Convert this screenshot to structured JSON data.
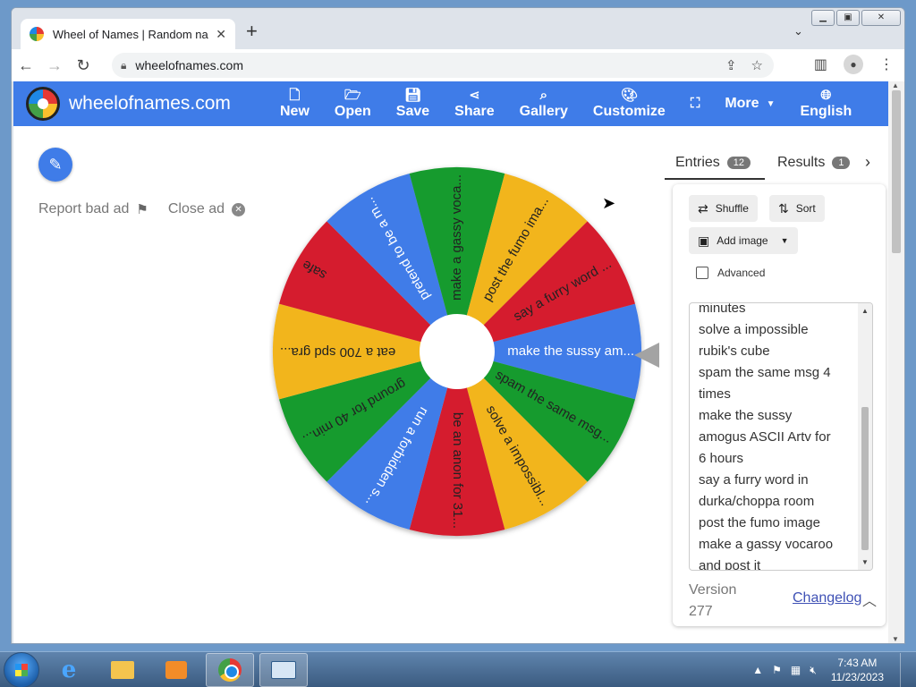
{
  "browser": {
    "tab_title": "Wheel of Names | Random name",
    "url": "wheelofnames.com",
    "window_controls": [
      "minimize-icon",
      "maximize-icon",
      "close-icon"
    ]
  },
  "appbar": {
    "brand": "wheelofnames.com",
    "menu": [
      {
        "label": "New",
        "icon": "file-icon"
      },
      {
        "label": "Open",
        "icon": "folder-open-icon"
      },
      {
        "label": "Save",
        "icon": "floppy-icon"
      },
      {
        "label": "Share",
        "icon": "share-icon"
      },
      {
        "label": "Gallery",
        "icon": "search-icon"
      },
      {
        "label": "Customize",
        "icon": "palette-icon"
      }
    ],
    "more_label": "More",
    "language_label": "English"
  },
  "ad": {
    "report_label": "Report bad ad",
    "close_label": "Close ad"
  },
  "wheel": {
    "slices": [
      {
        "label": "make the sussy am...",
        "color": "#3f7ce8"
      },
      {
        "label": "spam the same msg...",
        "color": "#169b2f"
      },
      {
        "label": "solve a impossibl...",
        "color": "#f2b51c"
      },
      {
        "label": "be an anon for 31...",
        "color": "#d51f2d"
      },
      {
        "label": "run a forbidden s...",
        "color": "#3f7ce8"
      },
      {
        "label": "ground for 40 min...",
        "color": "#169b2f"
      },
      {
        "label": "eat a 700 spd gra...",
        "color": "#f2b51c"
      },
      {
        "label": "safe",
        "color": "#d51f2d"
      },
      {
        "label": "pretend to be a m...",
        "color": "#3f7ce8"
      },
      {
        "label": "make a gassy voca...",
        "color": "#169b2f"
      },
      {
        "label": "post the fumo ima...",
        "color": "#f2b51c"
      },
      {
        "label": "say a furry word ...",
        "color": "#d51f2d"
      }
    ]
  },
  "panel": {
    "entries_label": "Entries",
    "entries_count": "12",
    "results_label": "Results",
    "results_count": "1",
    "shuffle_label": "Shuffle",
    "sort_label": "Sort",
    "add_image_label": "Add image",
    "advanced_label": "Advanced",
    "entries_lines": [
      "minutes",
      "solve a impossible",
      "rubik's cube",
      "spam the same msg 4",
      "times",
      "make the sussy",
      "amogus ASCII Artv for",
      "6 hours",
      "say a furry word in",
      "durka/choppa room",
      "post the fumo image",
      "make a gassy vocaroo",
      "and post it"
    ],
    "version_label": "Version",
    "version_number": "277",
    "changelog_label": "Changelog"
  },
  "taskbar": {
    "apps": [
      "start-orb",
      "internet-explorer-icon",
      "file-explorer-icon",
      "media-player-icon",
      "chrome-icon",
      "on-screen-keyboard-icon"
    ],
    "time": "7:43 AM",
    "date": "11/23/2023"
  }
}
